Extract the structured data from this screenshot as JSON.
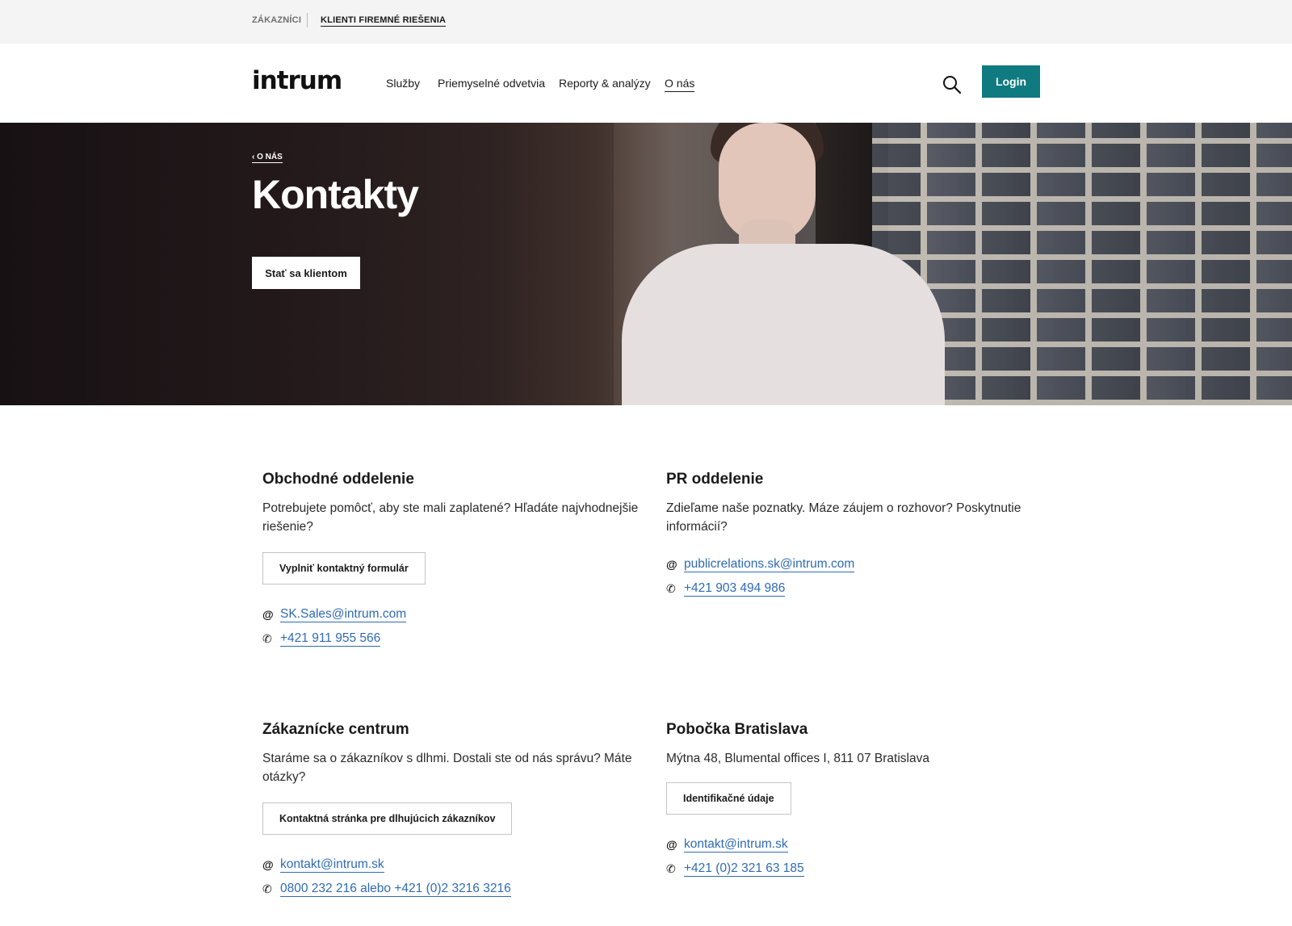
{
  "audience_bar": {
    "items": [
      {
        "label": "ZÁKAZNÍCI"
      },
      {
        "label": "KLIENTI FIREMNÉ RIEŠENIA"
      }
    ]
  },
  "header": {
    "logo": "intrum",
    "nav": [
      {
        "label": "Služby"
      },
      {
        "label": "Priemyselné odvetvia"
      },
      {
        "label": "Reporty & analýzy"
      },
      {
        "label": "O nás"
      }
    ],
    "login_label": "Login",
    "login_color": "#0f7a80"
  },
  "hero": {
    "breadcrumb": "‹ O NÁS",
    "title": "Kontakty",
    "cta_label": "Stať sa klientom"
  },
  "contacts": [
    {
      "title": "Obchodné oddelenie",
      "description": "Potrebujete pomôcť, aby ste mali zaplatené? Hľadáte najvhodnejšie riešenie?",
      "button_label": "Vyplniť kontaktný formulár",
      "email": "SK.Sales@intrum.com",
      "phone": "+421 911 955 566"
    },
    {
      "title": "PR oddelenie",
      "description": "Zdieľame naše poznatky. Máze záujem o rozhovor? Poskytnutie informácií?",
      "email": "publicrelations.sk@intrum.com",
      "phone": "+421 903 494 986"
    },
    {
      "title": "Zákaznícke centrum",
      "description": "Staráme sa o zákazníkov s dlhmi. Dostali ste od nás správu? Máte otázky?",
      "button_label": "Kontaktná stránka pre dlhujúcich zákazníkov",
      "email": "kontakt@intrum.sk",
      "phone": "0800 232 216 alebo +421 (0)2 3216 3216"
    },
    {
      "title": "Pobočka Bratislava",
      "description": "Mýtna 48, Blumental offices I, 811 07 Bratislava",
      "button_label": "Identifikačné údaje",
      "email": "kontakt@intrum.sk",
      "phone": "+421 (0)2 321 63 185"
    }
  ],
  "icons": {
    "email": "@",
    "phone": "✆"
  },
  "link_color": "#2f6bb5"
}
